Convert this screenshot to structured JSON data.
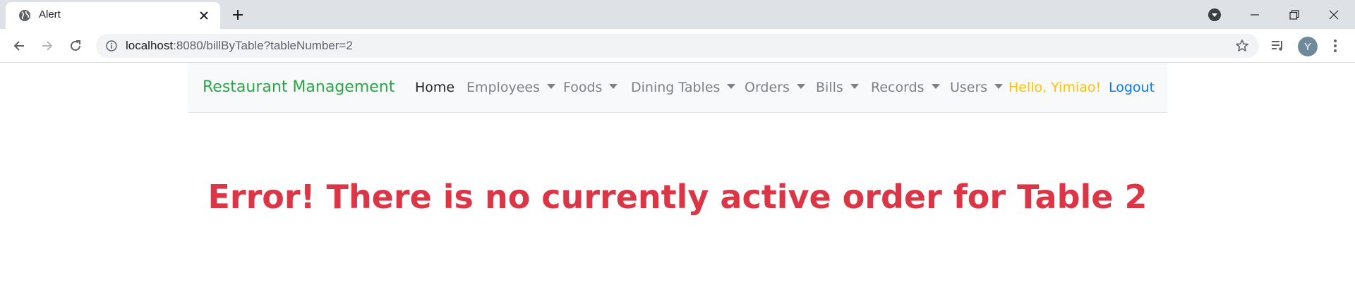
{
  "browser": {
    "tab": {
      "title": "Alert"
    },
    "address": {
      "host": "localhost",
      "rest": ":8080/billByTable?tableNumber=2"
    },
    "profile_initial": "Y"
  },
  "navbar": {
    "brand": "Restaurant Management",
    "items": [
      {
        "label": "Home",
        "dropdown": false,
        "active": true
      },
      {
        "label": "Employees",
        "dropdown": true
      },
      {
        "label": "Foods",
        "dropdown": true
      },
      {
        "label": "Dining Tables",
        "dropdown": true
      },
      {
        "label": "Orders",
        "dropdown": true
      },
      {
        "label": "Bills",
        "dropdown": true
      },
      {
        "label": "Records",
        "dropdown": true
      },
      {
        "label": "Users",
        "dropdown": true
      }
    ],
    "greeting": "Hello, Yimiao!",
    "logout": "Logout"
  },
  "alert": {
    "message": "Error! There is no currently active order for Table 2"
  },
  "colors": {
    "brand": "#28a745",
    "greeting": "#ffc107",
    "link": "#007bff",
    "error": "#dc3545"
  }
}
